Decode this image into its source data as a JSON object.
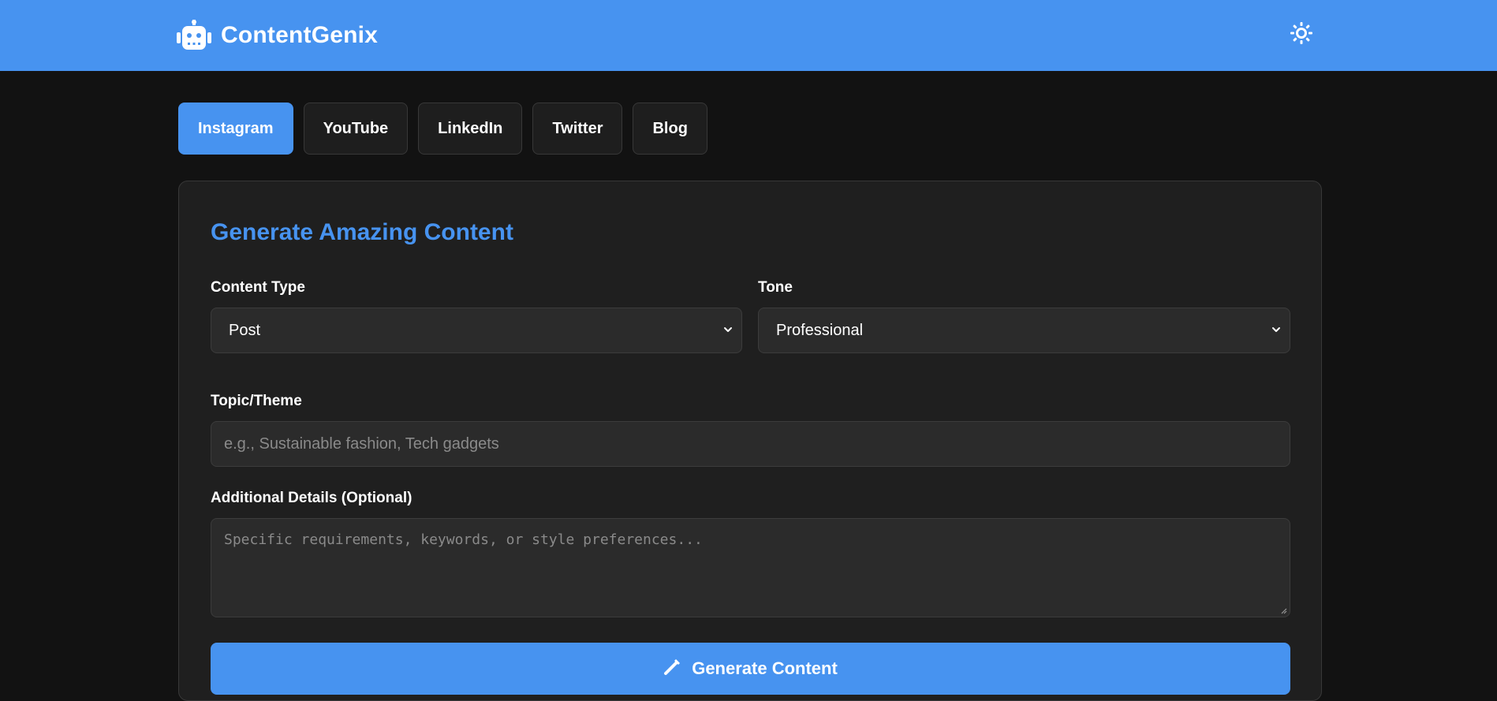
{
  "app": {
    "name": "ContentGenix",
    "logo_icon": "robot-icon",
    "theme_toggle_icon": "sun-icon"
  },
  "colors": {
    "accent": "#4793f0",
    "background": "#121212",
    "card": "#1f1f1f",
    "field": "#2b2b2b"
  },
  "tabs": [
    {
      "label": "Instagram",
      "active": true
    },
    {
      "label": "YouTube",
      "active": false
    },
    {
      "label": "LinkedIn",
      "active": false
    },
    {
      "label": "Twitter",
      "active": false
    },
    {
      "label": "Blog",
      "active": false
    }
  ],
  "form": {
    "title": "Generate Amazing Content",
    "content_type": {
      "label": "Content Type",
      "value": "Post"
    },
    "tone": {
      "label": "Tone",
      "value": "Professional"
    },
    "topic": {
      "label": "Topic/Theme",
      "placeholder": "e.g., Sustainable fashion, Tech gadgets",
      "value": ""
    },
    "details": {
      "label": "Additional Details (Optional)",
      "placeholder": "Specific requirements, keywords, or style preferences...",
      "value": ""
    },
    "submit": {
      "label": "Generate Content",
      "icon": "magic-wand-icon"
    }
  }
}
